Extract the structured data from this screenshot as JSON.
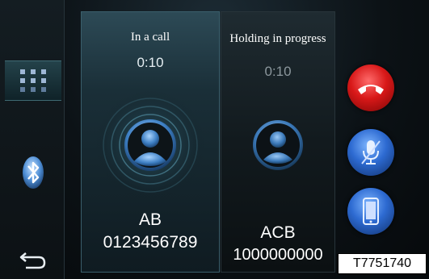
{
  "left_rail": {
    "keypad_icon": "keypad-grid-icon",
    "bluetooth_icon": "bluetooth-icon",
    "back_icon": "back-arrow-icon"
  },
  "calls": [
    {
      "status": "In a call",
      "timer": "0:10",
      "name": "AB",
      "number": "0123456789",
      "avatar_icon": "contact-avatar-icon"
    },
    {
      "status": "Holding in progress",
      "timer": "0:10",
      "name": "ACB",
      "number": "1000000000",
      "avatar_icon": "contact-avatar-icon"
    }
  ],
  "actions": {
    "hangup_icon": "hang-up-icon",
    "mute_icon": "microphone-mute-icon",
    "device_icon": "phone-device-icon"
  },
  "figure_label": "T7751740",
  "colors": {
    "hangup": "#d81818",
    "action_blue": "#2d6ad1",
    "accent": "#3f6a73"
  }
}
